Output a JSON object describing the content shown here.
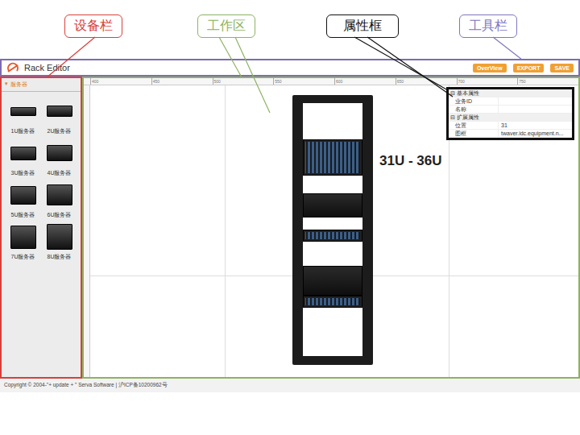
{
  "annotations": [
    {
      "label": "设备栏",
      "color": "#d9403a"
    },
    {
      "label": "工作区",
      "color": "#8db360"
    },
    {
      "label": "属性框",
      "color": "#111111"
    },
    {
      "label": "工具栏",
      "color": "#8076c0"
    }
  ],
  "app": {
    "title": "Rack Editor"
  },
  "toolbar": {
    "buttons": [
      "OverView",
      "EXPORT",
      "SAVE"
    ]
  },
  "device_panel": {
    "group": {
      "arrow": "▾",
      "label": "服务器",
      "expanded": true
    },
    "items": [
      {
        "label": "1U服务器",
        "units": 1
      },
      {
        "label": "2U服务器",
        "units": 2
      },
      {
        "label": "3U服务器",
        "units": 3
      },
      {
        "label": "4U服务器",
        "units": 4
      },
      {
        "label": "5U服务器",
        "units": 5
      },
      {
        "label": "6U服务器",
        "units": 6
      },
      {
        "label": "7U服务器",
        "units": 7
      },
      {
        "label": "8U服务器",
        "units": 8
      }
    ]
  },
  "ruler": {
    "ticks": [
      "400",
      "450",
      "500",
      "550",
      "600",
      "650",
      "700",
      "750"
    ]
  },
  "rack": {
    "units": 42,
    "devices": [
      {
        "start": 31,
        "size": 6,
        "kind": "blue"
      },
      {
        "start": 24,
        "size": 4,
        "kind": "black"
      },
      {
        "start": 20,
        "size": 2,
        "kind": "blue"
      },
      {
        "start": 11,
        "size": 5,
        "kind": "black"
      },
      {
        "start": 9,
        "size": 2,
        "kind": "blue"
      }
    ]
  },
  "rack_label": "31U - 36U",
  "properties": {
    "groups": [
      {
        "toggle": "⊟",
        "title": "基本属性",
        "expanded": true,
        "rows": [
          {
            "name": "业务ID",
            "value": ""
          },
          {
            "name": "名称",
            "value": ""
          }
        ]
      },
      {
        "toggle": "⊟",
        "title": "扩展属性",
        "expanded": true,
        "rows": [
          {
            "name": "位置",
            "value": "31"
          },
          {
            "name": "图框",
            "value": "twaver.idc.equipment.n..."
          }
        ]
      }
    ]
  },
  "footer": "Copyright © 2004-\"+ update + \" Serva Software | 沪ICP备10200962号"
}
